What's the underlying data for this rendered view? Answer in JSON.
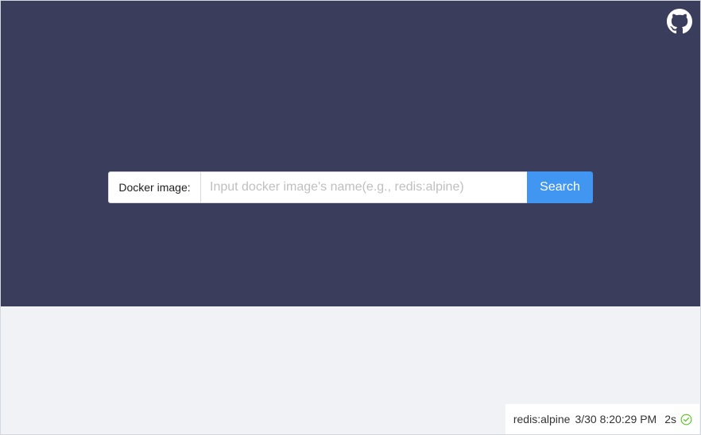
{
  "colors": {
    "hero_background": "#3b3d5c",
    "page_background": "#f0f2f5",
    "primary_button": "#4096f0",
    "success": "#52c41a"
  },
  "header": {
    "github_icon": "github-icon"
  },
  "search": {
    "label": "Docker image:",
    "placeholder": "Input docker image's name(e.g., redis:alpine)",
    "value": "",
    "button_label": "Search"
  },
  "history": {
    "items": [
      {
        "image": "redis:alpine",
        "time": "3/30 8:20:29 PM",
        "duration": "2s",
        "status_icon": "check-circle-icon"
      }
    ]
  }
}
